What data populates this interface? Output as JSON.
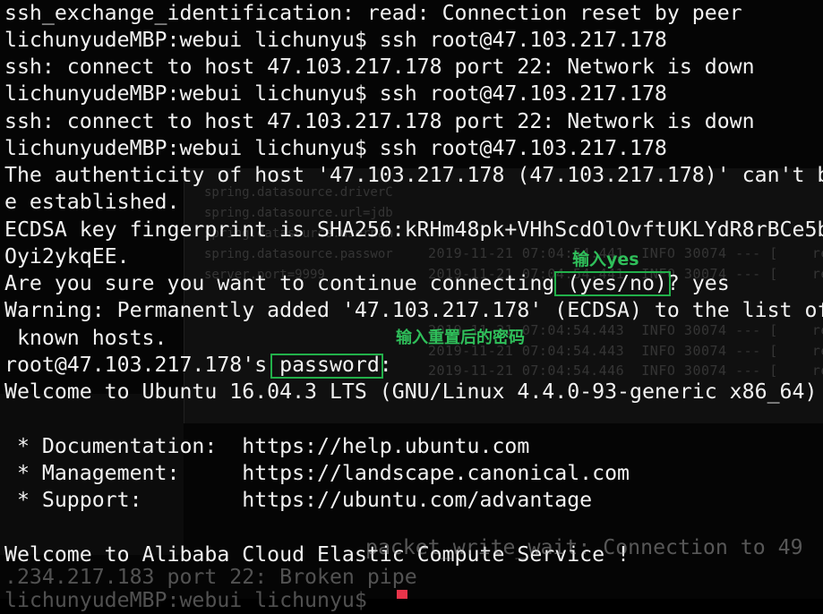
{
  "terminal": {
    "lines": [
      "ssh_exchange_identification: read: Connection reset by peer",
      "lichunyudeMBP:webui lichunyu$ ssh root@47.103.217.178",
      "ssh: connect to host 47.103.217.178 port 22: Network is down",
      "lichunyudeMBP:webui lichunyu$ ssh root@47.103.217.178",
      "ssh: connect to host 47.103.217.178 port 22: Network is down",
      "lichunyudeMBP:webui lichunyu$ ssh root@47.103.217.178",
      "The authenticity of host '47.103.217.178 (47.103.217.178)' can't b",
      "e established.",
      "ECDSA key fingerprint is SHA256:kRHm48pk+VHhScdOlOvftUKLYdR8rBCe5b",
      "Oyi2ykqEE.",
      "Are you sure you want to continue connecting (yes/no)? yes",
      "Warning: Permanently added '47.103.217.178' (ECDSA) to the list of",
      " known hosts.",
      "root@47.103.217.178's password:",
      "Welcome to Ubuntu 16.04.3 LTS (GNU/Linux 4.4.0-93-generic x86_64)",
      "",
      " * Documentation:  https://help.ubuntu.com",
      " * Management:     https://landscape.canonical.com",
      " * Support:        https://ubuntu.com/advantage",
      "",
      "Welcome to Alibaba Cloud Elastic Compute Service !",
      ".234.217.183 port 22: Broken pipe",
      "lichunyudeMBP:webui lichunyu$ "
    ],
    "overlay_text": "packet_write_wait: Connection to 49"
  },
  "annotations": {
    "yes_note": "输入yes",
    "password_note": "输入重置后的密码"
  },
  "background_window": {
    "code_lines": [
      "spring.datasource.driverC",
      "spring.datasource.url=jdb",
      "spring.datasource.usernam",
      "spring.datasource.passwor",
      "server.port=9999"
    ],
    "log_lines": [
      "2019-11-21 07:04:54.441  INFO 30074 --- [    re",
      "2019-11-21 07:04:54.441  INFO 30074 --- [    re",
      "2019-11-21 07:04:54.443  INFO 30074 --- [    re",
      "2019-11-21 07:04:54.443  INFO 30074 --- [    re",
      "2019-11-21 07:04:54.446  INFO 30074 --- [    re"
    ]
  }
}
